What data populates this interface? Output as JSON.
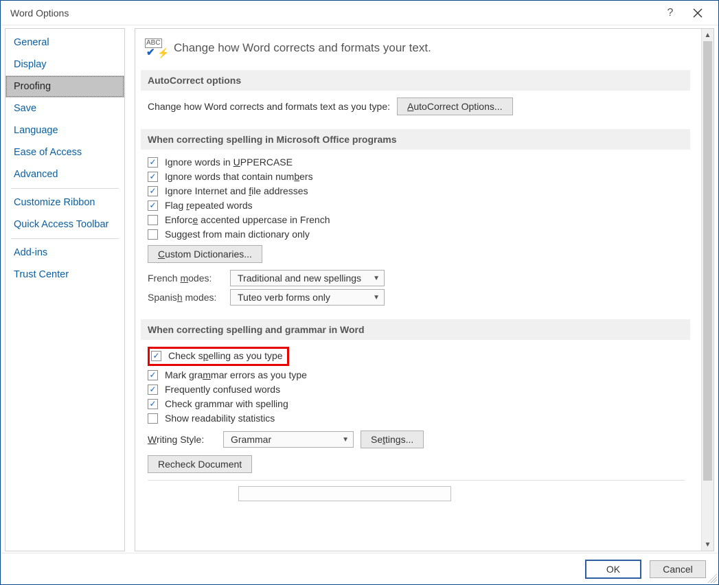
{
  "window": {
    "title": "Word Options"
  },
  "sidebar": {
    "items": [
      {
        "label": "General",
        "selected": false
      },
      {
        "label": "Display",
        "selected": false
      },
      {
        "label": "Proofing",
        "selected": true
      },
      {
        "label": "Save",
        "selected": false
      },
      {
        "label": "Language",
        "selected": false
      },
      {
        "label": "Ease of Access",
        "selected": false
      },
      {
        "label": "Advanced",
        "selected": false
      },
      {
        "label": "Customize Ribbon",
        "selected": false
      },
      {
        "label": "Quick Access Toolbar",
        "selected": false
      },
      {
        "label": "Add-ins",
        "selected": false
      },
      {
        "label": "Trust Center",
        "selected": false
      }
    ]
  },
  "main": {
    "heading": "Change how Word corrects and formats your text.",
    "autocorrect": {
      "title": "AutoCorrect options",
      "desc": "Change how Word corrects and formats text as you type:",
      "button": "AutoCorrect Options..."
    },
    "office_spelling": {
      "title": "When correcting spelling in Microsoft Office programs",
      "chk_uppercase": "Ignore words in UPPERCASE",
      "chk_numbers": "Ignore words that contain numbers",
      "chk_internet": "Ignore Internet and file addresses",
      "chk_repeated": "Flag repeated words",
      "chk_french_accent": "Enforce accented uppercase in French",
      "chk_main_dict": "Suggest from main dictionary only",
      "custom_dict_btn": "Custom Dictionaries...",
      "french_label": "French modes:",
      "french_value": "Traditional and new spellings",
      "spanish_label": "Spanish modes:",
      "spanish_value": "Tuteo verb forms only"
    },
    "word_spelling": {
      "title": "When correcting spelling and grammar in Word",
      "chk_spell_type": "Check spelling as you type",
      "chk_grammar_type": "Mark grammar errors as you type",
      "chk_confused": "Frequently confused words",
      "chk_grammar_spell": "Check grammar with spelling",
      "chk_readability": "Show readability statistics",
      "writing_style_label": "Writing Style:",
      "writing_style_value": "Grammar",
      "settings_btn": "Settings...",
      "recheck_btn": "Recheck Document"
    }
  },
  "footer": {
    "ok": "OK",
    "cancel": "Cancel"
  }
}
